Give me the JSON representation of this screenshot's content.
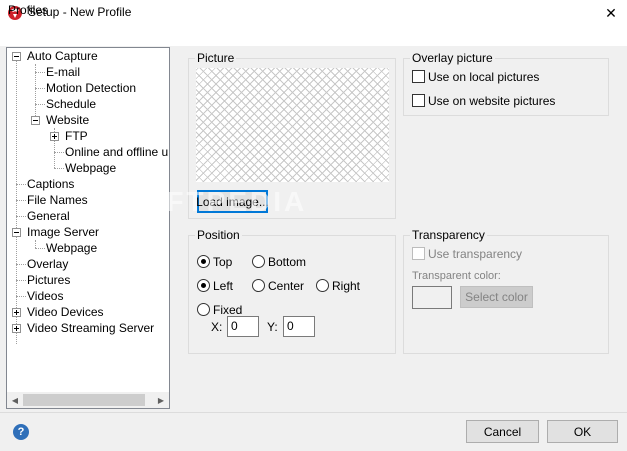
{
  "window": {
    "title": "Setup - New Profile",
    "close_glyph": "✕",
    "icon": "app-logo-icon"
  },
  "menu": {
    "items": [
      {
        "label": "Profiles"
      }
    ]
  },
  "tree": {
    "nodes": [
      {
        "label": "Auto Capture",
        "expander": "minus"
      },
      {
        "label": "E-mail"
      },
      {
        "label": "Motion Detection"
      },
      {
        "label": "Schedule"
      },
      {
        "label": "Website",
        "expander": "minus"
      },
      {
        "label": "FTP",
        "expander": "plus"
      },
      {
        "label": "Online and offline uplo"
      },
      {
        "label": "Webpage"
      },
      {
        "label": "Captions"
      },
      {
        "label": "File Names"
      },
      {
        "label": "General"
      },
      {
        "label": "Image Server",
        "expander": "minus"
      },
      {
        "label": "Webpage"
      },
      {
        "label": "Overlay"
      },
      {
        "label": "Pictures"
      },
      {
        "label": "Videos"
      },
      {
        "label": "Video Devices",
        "expander": "plus"
      },
      {
        "label": "Video Streaming Server",
        "expander": "plus"
      }
    ],
    "scroll_left": "◀",
    "scroll_right": "▶"
  },
  "picture": {
    "title": "Picture",
    "load_button": "Load image...",
    "watermark": "SOFTPEDIA"
  },
  "overlay": {
    "title": "Overlay picture",
    "use_local": "Use on local pictures",
    "use_website": "Use on website pictures",
    "use_local_checked": false,
    "use_website_checked": false
  },
  "position": {
    "title": "Position",
    "top": "Top",
    "bottom": "Bottom",
    "left": "Left",
    "center": "Center",
    "right": "Right",
    "fixed": "Fixed",
    "x_label": "X:",
    "x_value": "0",
    "y_label": "Y:",
    "y_value": "0",
    "vertical_selected": "Top",
    "horizontal_selected": "Left"
  },
  "transparency": {
    "title": "Transparency",
    "use_transparency": "Use transparency",
    "color_label": "Transparent color:",
    "select_color": "Select color"
  },
  "footer": {
    "help_glyph": "?",
    "cancel": "Cancel",
    "ok": "OK"
  },
  "colors": {
    "focus_border": "#0078d7",
    "help_icon_bg": "#2f6fb9",
    "dialog_bg": "#f0f0f0"
  }
}
